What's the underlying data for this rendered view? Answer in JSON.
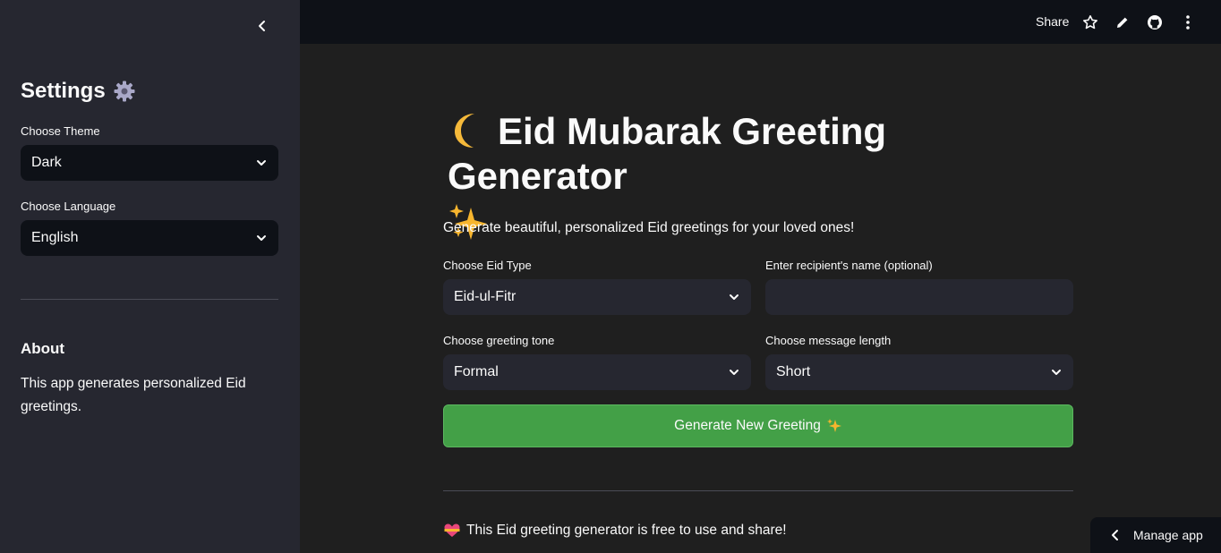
{
  "sidebar": {
    "title": "Settings",
    "title_icon": "gear-icon",
    "theme_label": "Choose Theme",
    "theme_value": "Dark",
    "language_label": "Choose Language",
    "language_value": "English",
    "about_title": "About",
    "about_text": "This app generates personalized Eid greetings."
  },
  "header": {
    "share_label": "Share",
    "icons": [
      "star-icon",
      "pencil-icon",
      "github-icon",
      "more-vertical-icon"
    ]
  },
  "main": {
    "title": "Eid Mubarak Greeting Generator",
    "subtitle": "Generate beautiful, personalized Eid greetings for your loved ones!",
    "eid_type_label": "Choose Eid Type",
    "eid_type_value": "Eid-ul-Fitr",
    "recipient_label": "Enter recipient's name (optional)",
    "recipient_value": "",
    "tone_label": "Choose greeting tone",
    "tone_value": "Formal",
    "length_label": "Choose message length",
    "length_value": "Short",
    "generate_label": "Generate New Greeting",
    "footer_text": "This Eid greeting generator is free to use and share!"
  },
  "manage_app": {
    "label": "Manage app"
  },
  "colors": {
    "sidebar_bg": "#262730",
    "main_bg": "#1f1f1f",
    "header_bg": "#0e1117",
    "button_green": "#43a047",
    "text": "#fafafa"
  }
}
